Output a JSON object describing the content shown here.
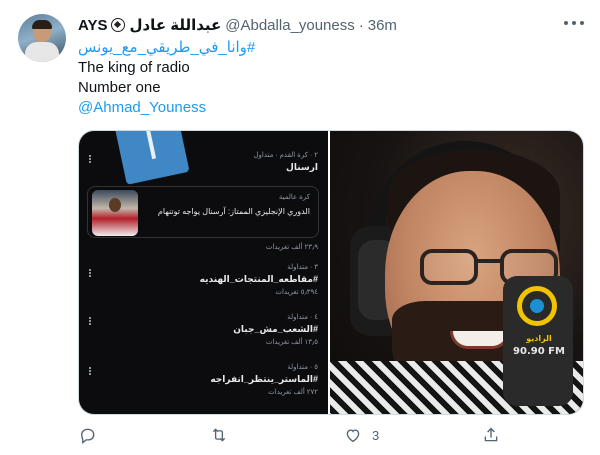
{
  "tweet": {
    "display_name": "AYS",
    "display_name_arabic": "عبداللة عادل",
    "name_emoji_icon": "soccer-ball-icon",
    "handle": "@Abdalla_youness",
    "separator": "·",
    "time": "36m",
    "more_icon": "more-horizontal-icon",
    "hashtag": "#وانا_في_طريقي_مع_يونس",
    "lines": [
      "The king of radio",
      "Number one"
    ],
    "mention": "@Ahmad_Youness"
  },
  "media": {
    "left_screenshot": {
      "trends": [
        {
          "meta": "٢ · كرة القدم · متداول",
          "name": "ارسنال",
          "count": ""
        },
        {
          "meta": "٣ · متداولة",
          "name": "#مقاطعه_المنتجات_الهنديه",
          "count": "٥٫٣٩٤ تغريدات"
        },
        {
          "meta": "٤ · متداولة",
          "name": "#الشعب_مش_جبان",
          "count": "١٣٫٥ ألف تغريدات"
        },
        {
          "meta": "٥ · متداولة",
          "name": "#الماستر_ينتظر_انفراجه",
          "count": "٢٧٢ ألف تغريدات"
        }
      ],
      "news": {
        "meta": "كرة عالمية",
        "title": "الدوري الإنجليزي الممتاز: آرسنال يواجه توتنهام",
        "count": "٢٣٫٩ ألف تغريدات"
      }
    },
    "right_photo": {
      "logo_text": "الراديو",
      "logo_freq": "90.90 FM"
    }
  },
  "actions": {
    "reply_icon": "reply-icon",
    "retweet_icon": "retweet-icon",
    "like_icon": "heart-icon",
    "like_count": "3",
    "share_icon": "share-icon"
  }
}
